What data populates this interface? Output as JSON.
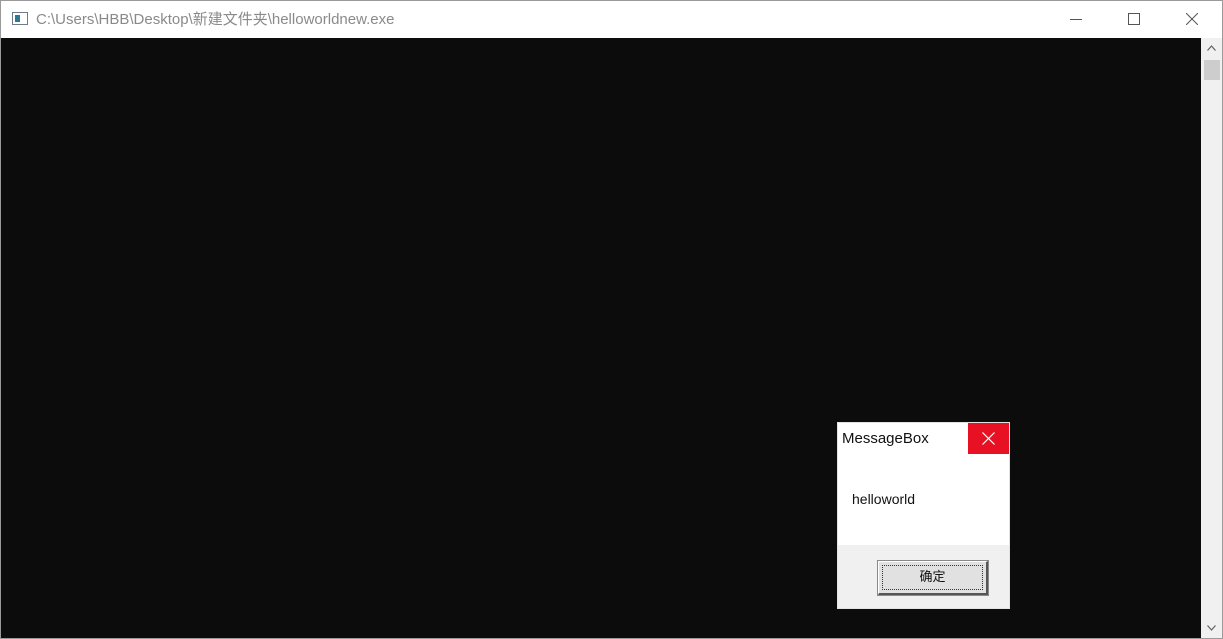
{
  "window": {
    "title": "C:\\Users\\HBB\\Desktop\\新建文件夹\\helloworldnew.exe",
    "icon": "console-app-icon",
    "controls": {
      "minimize": "minimize-icon",
      "maximize": "maximize-icon",
      "close": "close-icon"
    }
  },
  "console": {
    "background": "#0c0c0c"
  },
  "messagebox": {
    "title": "MessageBox",
    "text": "helloworld",
    "ok_label": "确定",
    "close_hover_color": "#e81123"
  }
}
